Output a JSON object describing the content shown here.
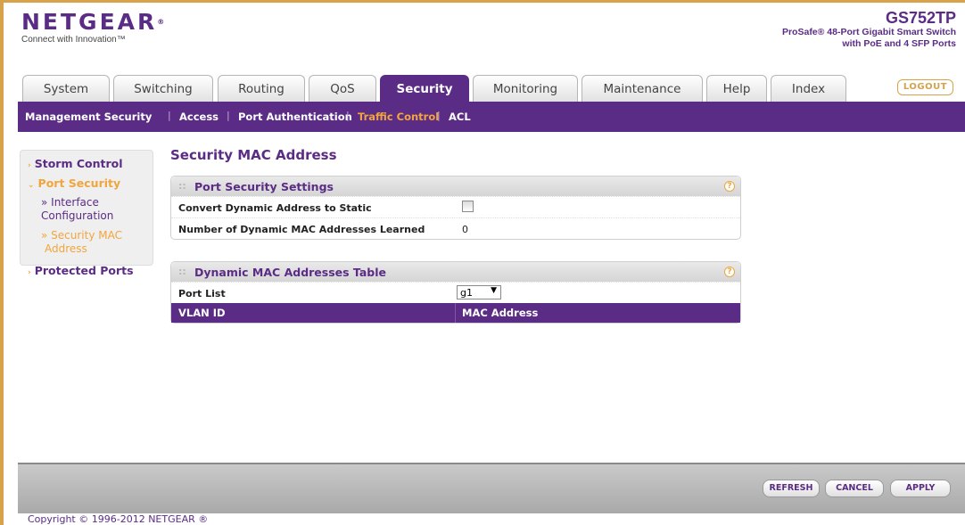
{
  "header": {
    "logo": "NETGEAR",
    "logo_reg": "®",
    "tagline": "Connect with Innovation™",
    "model": "GS752TP",
    "model_desc_1": "ProSafe® 48-Port Gigabit Smart Switch",
    "model_desc_2": "with PoE and 4 SFP Ports"
  },
  "tabs": [
    {
      "label": "System",
      "active": false
    },
    {
      "label": "Switching",
      "active": false
    },
    {
      "label": "Routing",
      "active": false
    },
    {
      "label": "QoS",
      "active": false
    },
    {
      "label": "Security",
      "active": true
    },
    {
      "label": "Monitoring",
      "active": false
    },
    {
      "label": "Maintenance",
      "active": false
    },
    {
      "label": "Help",
      "active": false
    },
    {
      "label": "Index",
      "active": false
    }
  ],
  "logout_label": "LOGOUT",
  "subnav": [
    {
      "label": "Management Security",
      "active": false
    },
    {
      "label": "Access",
      "active": false
    },
    {
      "label": "Port Authentication",
      "active": false
    },
    {
      "label": "Traffic Control",
      "active": true
    },
    {
      "label": "ACL",
      "active": false
    }
  ],
  "subnav_separator": "|",
  "sidebar": {
    "storm_control": "Storm Control",
    "port_security": "Port Security",
    "interface_config_1": "» Interface",
    "interface_config_2": "Configuration",
    "security_mac_1": "» Security MAC",
    "security_mac_2": "Address",
    "protected_ports": "Protected Ports",
    "arrow_closed": "›",
    "arrow_open": "⌄"
  },
  "main": {
    "title": "Security MAC Address",
    "port_security_settings": {
      "title": "Port Security Settings",
      "convert_label": "Convert Dynamic Address to Static",
      "convert_checked": false,
      "learned_label": "Number of Dynamic MAC Addresses Learned",
      "learned_value": "0"
    },
    "dynamic_table": {
      "title": "Dynamic MAC Addresses Table",
      "port_list_label": "Port List",
      "port_list_value": "g1",
      "columns": [
        "VLAN ID",
        "MAC Address"
      ]
    },
    "grip": "::",
    "help": "?"
  },
  "footer": {
    "refresh": "REFRESH",
    "cancel": "CANCEL",
    "apply": "APPLY",
    "copyright": "Copyright © 1996-2012 NETGEAR ®"
  },
  "colors": {
    "brand_purple": "#5b2c85",
    "accent_orange": "#f2a53c",
    "frame_gold": "#d8a24b"
  }
}
